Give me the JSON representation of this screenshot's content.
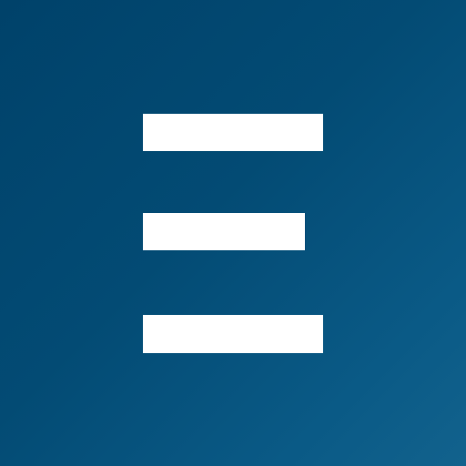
{
  "app_icon": {
    "icon_name": "hamburger-menu-icon",
    "background_gradient": [
      "#00426a",
      "#034b74",
      "#0a5a86",
      "#12628d"
    ],
    "foreground_color": "#ffffff",
    "bars": [
      "top",
      "middle",
      "bottom"
    ]
  }
}
